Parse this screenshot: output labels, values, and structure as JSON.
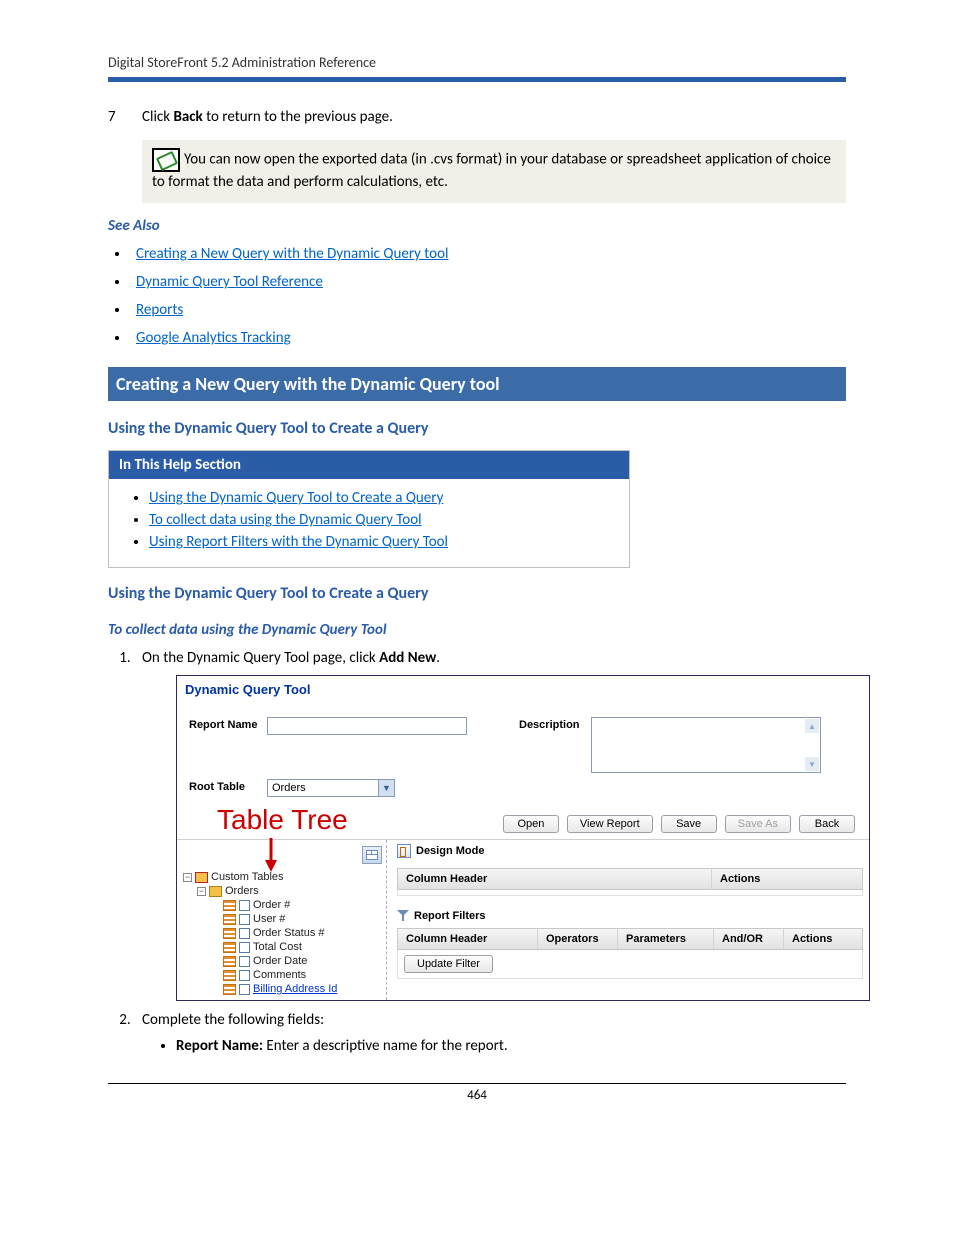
{
  "header": {
    "title": "Digital StoreFront 5.2 Administration Reference"
  },
  "step7": {
    "num": "7",
    "pre": "Click ",
    "bold": "Back",
    "post": " to return to the previous page."
  },
  "note": {
    "text": "You can now open the exported data (in .cvs format) in your database or spreadsheet application of choice to format the data and perform calculations, etc."
  },
  "see_also": {
    "title": "See Also",
    "links": [
      "Creating a New Query with the Dynamic Query tool",
      "Dynamic Query Tool Reference",
      "Reports",
      "Google Analytics Tracking"
    ]
  },
  "banner": {
    "text": "Creating a New Query with the Dynamic Query tool"
  },
  "sub1": {
    "text": "Using the Dynamic Query Tool to Create a Query"
  },
  "help_box": {
    "header": "In This Help Section",
    "items": [
      "Using the Dynamic Query Tool to Create a Query",
      "To collect data using the Dynamic Query Tool",
      "Using Report Filters with the Dynamic Query Tool"
    ]
  },
  "sub2": {
    "text": "Using the Dynamic Query Tool to Create a Query"
  },
  "blue_italic": {
    "text": "To collect data using the Dynamic Query Tool"
  },
  "ol": {
    "item1_pre": "On the Dynamic Query Tool page, click ",
    "item1_bold": "Add New",
    "item1_post": ".",
    "item2": "Complete the following fields:",
    "bullet1_bold": "Report Name:",
    "bullet1_rest": " Enter a descriptive name for the report."
  },
  "figure": {
    "title": "Dynamic Query Tool",
    "labels": {
      "report_name": "Report Name",
      "root_table": "Root Table",
      "description": "Description"
    },
    "root_table_value": "Orders",
    "buttons": {
      "open": "Open",
      "view_report": "View Report",
      "save": "Save",
      "save_as": "Save As",
      "back": "Back"
    },
    "annotation": "Table Tree",
    "design_mode": "Design Mode",
    "grid1": {
      "col1": "Column Header",
      "col2": "Actions"
    },
    "filters_title": "Report Filters",
    "grid2": {
      "c1": "Column Header",
      "c2": "Operators",
      "c3": "Parameters",
      "c4": "And/OR",
      "c5": "Actions"
    },
    "update_filter": "Update Filter",
    "tree": {
      "root": "Custom Tables",
      "orders": "Orders",
      "children": [
        "Order #",
        "User #",
        "Order Status #",
        "Total Cost",
        "Order Date",
        "Comments",
        "Billing Address Id"
      ]
    }
  },
  "page_number": "464"
}
